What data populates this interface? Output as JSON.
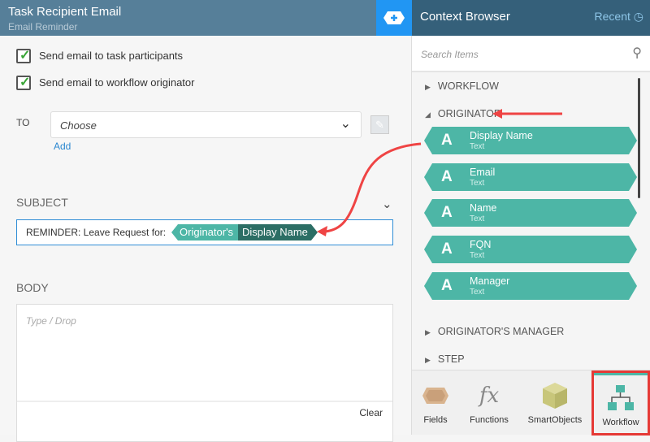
{
  "editor": {
    "title": "Task Recipient Email",
    "subtitle": "Email Reminder",
    "options": [
      {
        "label": "Send email to task participants",
        "checked": true
      },
      {
        "label": "Send email to workflow originator",
        "checked": true
      }
    ],
    "to_label": "TO",
    "to_value": "Choose",
    "add_link": "Add",
    "subject_label": "SUBJECT",
    "subject_prefix": "REMINDER: Leave Request for:",
    "subject_tokens": [
      "Originator's",
      "Display Name"
    ],
    "body_label": "BODY",
    "body_placeholder": "Type / Drop",
    "clear_label": "Clear"
  },
  "context": {
    "title": "Context Browser",
    "recent_label": "Recent",
    "search_placeholder": "Search Items",
    "nodes": [
      "WORKFLOW",
      "ORIGINATOR",
      "ORIGINATOR'S MANAGER",
      "STEP"
    ],
    "items": [
      {
        "name": "Display Name",
        "type": "Text"
      },
      {
        "name": "Email",
        "type": "Text"
      },
      {
        "name": "Name",
        "type": "Text"
      },
      {
        "name": "FQN",
        "type": "Text"
      },
      {
        "name": "Manager",
        "type": "Text"
      }
    ],
    "tabs": [
      {
        "label": "Fields",
        "icon": "fields-icon"
      },
      {
        "label": "Functions",
        "icon": "fx-icon"
      },
      {
        "label": "SmartObjects",
        "icon": "cube-icon"
      },
      {
        "label": "Workflow",
        "icon": "workflow-icon",
        "active": true
      }
    ]
  },
  "colors": {
    "accent": "#4db6a6",
    "dark_token": "#2c6e65",
    "header": "#567f99",
    "annotation": "#e53935"
  }
}
